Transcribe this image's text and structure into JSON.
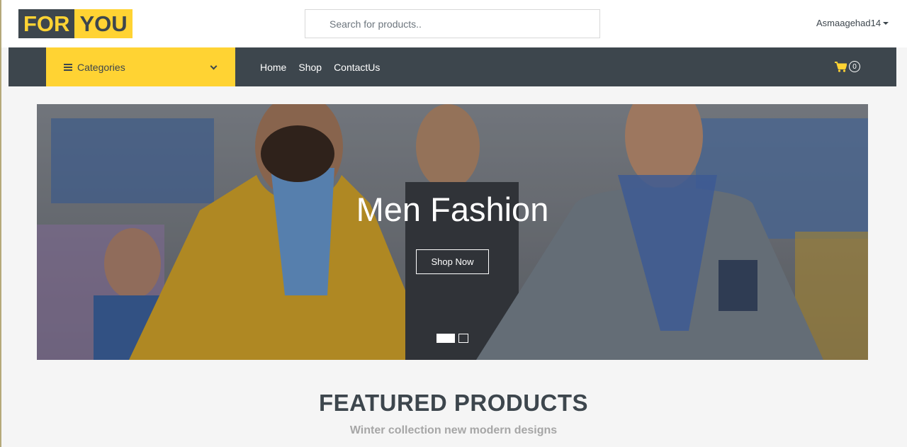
{
  "brand": {
    "part1": "FOR",
    "part2": "YOU"
  },
  "search": {
    "placeholder": "Search for products.."
  },
  "user": {
    "name": "Asmaagehad14"
  },
  "nav": {
    "categories_label": "Categories",
    "links": [
      "Home",
      "Shop",
      "ContactUs"
    ],
    "cart_count": "0"
  },
  "hero": {
    "title": "Men Fashion",
    "button_label": "Shop Now",
    "slide_count": 2,
    "active_slide": 1
  },
  "featured": {
    "title": "FEATURED PRODUCTS",
    "subtitle": "Winter collection new modern designs"
  },
  "colors": {
    "accent": "#ffd333",
    "dark": "#3d464d",
    "background": "#f5f5f5"
  }
}
